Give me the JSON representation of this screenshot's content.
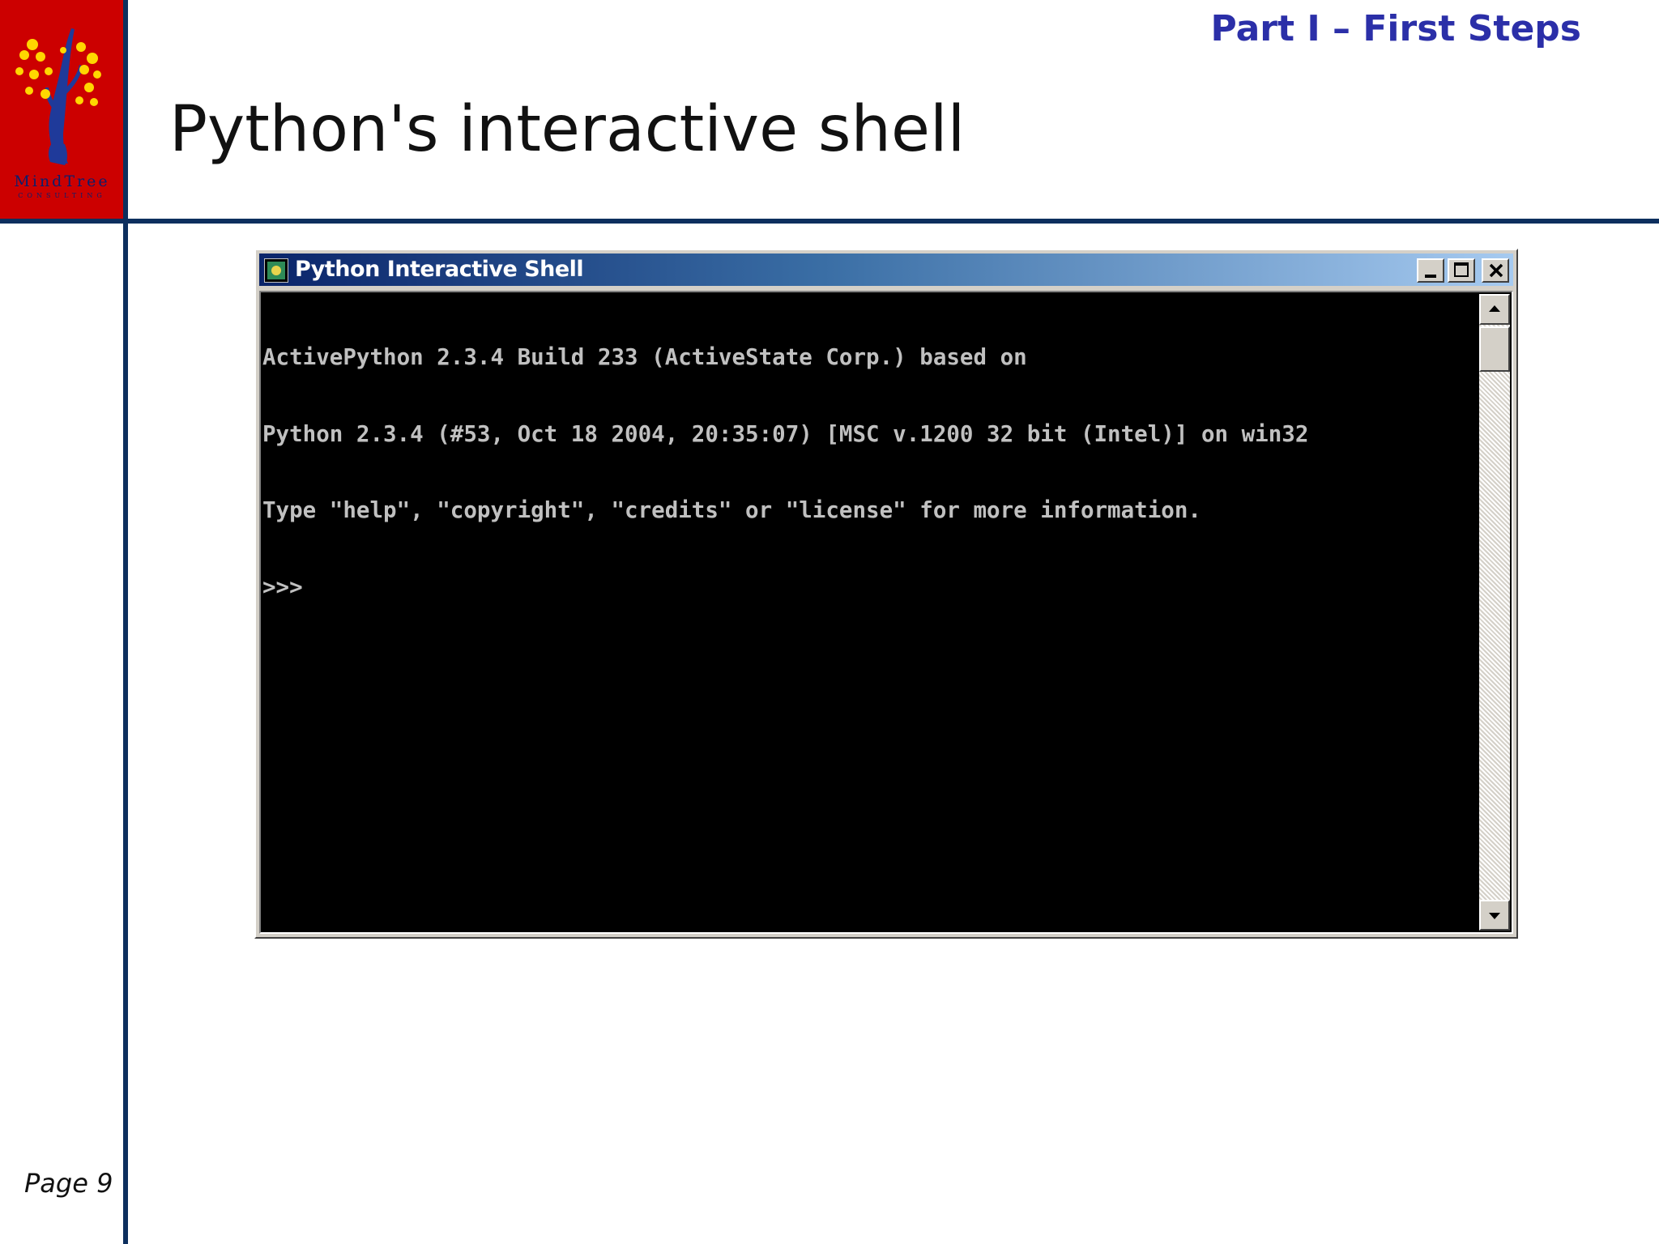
{
  "slide": {
    "section_title": "Part I – First Steps",
    "page_title": "Python's interactive shell",
    "page_number": "Page 9"
  },
  "logo": {
    "name": "MindTree",
    "subtitle": "CONSULTING",
    "background_color": "#cc0000",
    "accent_color": "#ffd700",
    "text_color": "#0a1f6e"
  },
  "window": {
    "title": "Python Interactive Shell",
    "icon": "python-app-icon",
    "controls": {
      "minimize": "minimize-icon",
      "maximize": "maximize-icon",
      "close": "close-icon"
    },
    "console_lines": [
      "ActivePython 2.3.4 Build 233 (ActiveState Corp.) based on",
      "Python 2.3.4 (#53, Oct 18 2004, 20:35:07) [MSC v.1200 32 bit (Intel)] on win32",
      "Type \"help\", \"copyright\", \"credits\" or \"license\" for more information.",
      ">>>"
    ],
    "scrollbar": {
      "up": "scroll-up-arrow-icon",
      "down": "scroll-down-arrow-icon"
    }
  },
  "colors": {
    "rule": "#0d2f5e",
    "section_title": "#2b2fa8",
    "console_bg": "#000000",
    "console_fg": "#c0c0c0",
    "titlebar_start": "#0a246a",
    "titlebar_end": "#a6caf0"
  }
}
